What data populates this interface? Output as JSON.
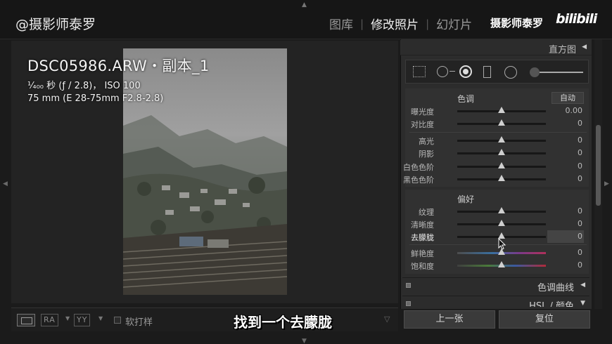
{
  "top_bar": {
    "identity": "@摄影师泰罗",
    "modules": [
      {
        "label": "图库",
        "active": false
      },
      {
        "label": "修改照片",
        "active": true
      },
      {
        "label": "幻灯片",
        "active": false
      }
    ],
    "watermark": "摄影师泰罗",
    "site_logo": "bilibili"
  },
  "photo_info": {
    "filename": "DSC05986.ARW・副本_1",
    "exposure": "¹⁄₄₀₀ 秒 (ƒ / 2.8)， ISO 100",
    "lens": "75 mm (E 28-75mm F2.8-2.8)"
  },
  "toolbar": {
    "compare_ra": "RA",
    "compare_yy": "YY",
    "soft_proof_label": "软打样"
  },
  "caption": "找到一个去朦胧",
  "right_panel": {
    "histogram_title": "直方图",
    "tone_section": {
      "title": "色调",
      "auto_label": "自动",
      "sliders": [
        {
          "label": "曝光度",
          "value": "0.00"
        },
        {
          "label": "对比度",
          "value": "0"
        },
        {
          "label": "高光",
          "value": "0"
        },
        {
          "label": "阴影",
          "value": "0"
        },
        {
          "label": "白色色阶",
          "value": "0"
        },
        {
          "label": "黑色色阶",
          "value": "0"
        }
      ]
    },
    "presence_section": {
      "title": "偏好",
      "sliders": [
        {
          "label": "纹理",
          "value": "0"
        },
        {
          "label": "清晰度",
          "value": "0"
        },
        {
          "label": "去朦胧",
          "value": "0"
        },
        {
          "label": "鲜艳度",
          "value": "0"
        },
        {
          "label": "饱和度",
          "value": "0"
        }
      ]
    },
    "tone_curve_title": "色调曲线",
    "hsl_title": "HSL / 颜色",
    "prev_button": "上一张",
    "reset_button": "复位"
  }
}
